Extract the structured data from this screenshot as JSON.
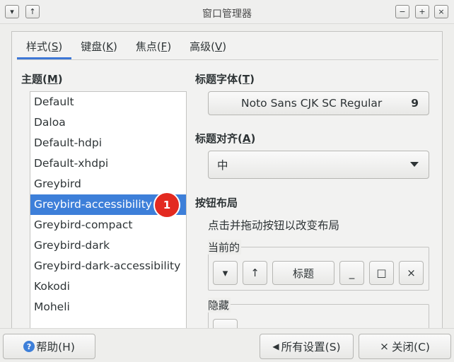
{
  "window": {
    "title": "窗口管理器",
    "menu_glyph": "▾",
    "raise_glyph": "↑",
    "minimize_glyph": "−",
    "maximize_glyph": "+",
    "close_glyph": "×"
  },
  "tabs": [
    {
      "prefix": "样式(",
      "key": "S",
      "suffix": ")",
      "active": true
    },
    {
      "prefix": "键盘(",
      "key": "K",
      "suffix": ")",
      "active": false
    },
    {
      "prefix": "焦点(",
      "key": "F",
      "suffix": ")",
      "active": false
    },
    {
      "prefix": "高级(",
      "key": "V",
      "suffix": ")",
      "active": false
    }
  ],
  "theme": {
    "label_prefix": "主题(",
    "label_key": "M",
    "label_suffix": ")",
    "items": [
      "Default",
      "Daloa",
      "Default-hdpi",
      "Default-xhdpi",
      "Greybird",
      "Greybird-accessibility",
      "Greybird-compact",
      "Greybird-dark",
      "Greybird-dark-accessibility",
      "Kokodi",
      "Moheli"
    ],
    "selected_index": 5,
    "badge": "1"
  },
  "title_font": {
    "label_prefix": "标题字体(",
    "label_key": "T",
    "label_suffix": ")",
    "font_name": "Noto Sans CJK SC Regular",
    "font_size": "9"
  },
  "title_align": {
    "label_prefix": "标题对齐(",
    "label_key": "A",
    "label_suffix": ")",
    "value": "中"
  },
  "button_layout": {
    "heading": "按钮布局",
    "hint": "点击并拖动按钮以改变布局",
    "current_label": "当前的",
    "hidden_label": "隐藏",
    "current_buttons": {
      "menu": "▾",
      "raise": "↑",
      "title": "标题",
      "minimize": "_",
      "maximize": "□",
      "close": "×"
    }
  },
  "footer": {
    "help": "帮助(H)",
    "all_settings": "所有设置(S)",
    "close": "关闭(C)",
    "help_icon_glyph": "?",
    "back_icon_glyph": "◀",
    "close_icon_glyph": "×"
  }
}
